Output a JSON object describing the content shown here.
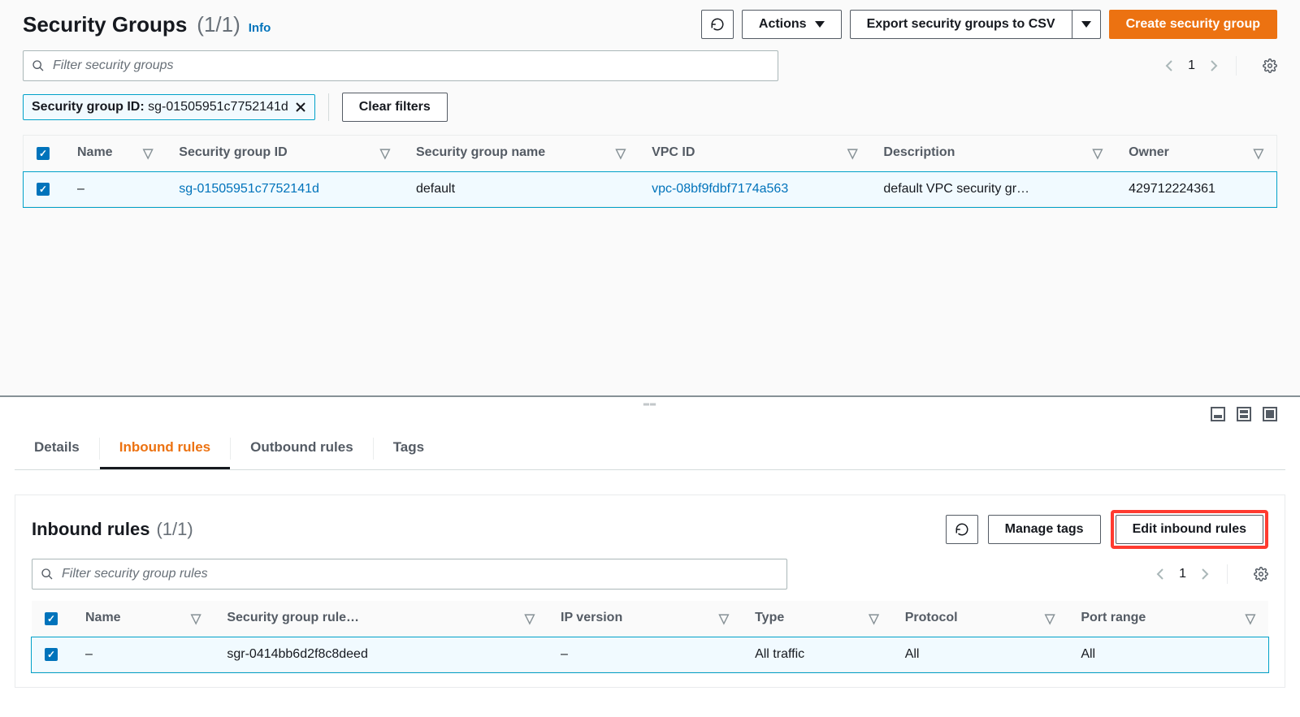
{
  "header": {
    "title": "Security Groups",
    "count": "(1/1)",
    "info": "Info"
  },
  "toolbar": {
    "actions": "Actions",
    "export": "Export security groups to CSV",
    "create": "Create security group"
  },
  "filter": {
    "placeholder": "Filter security groups",
    "chip_label": "Security group ID:",
    "chip_value": "sg-01505951c7752141d",
    "clear": "Clear filters",
    "page": "1"
  },
  "table": {
    "cols": [
      "Name",
      "Security group ID",
      "Security group name",
      "VPC ID",
      "Description",
      "Owner"
    ],
    "rows": [
      {
        "name": "–",
        "sgid": "sg-01505951c7752141d",
        "sgname": "default",
        "vpcid": "vpc-08bf9fdbf7174a563",
        "desc": "default VPC security gr…",
        "owner": "429712224361"
      }
    ]
  },
  "tabs": {
    "details": "Details",
    "inbound": "Inbound rules",
    "outbound": "Outbound rules",
    "tags": "Tags"
  },
  "detail": {
    "title": "Inbound rules",
    "count": "(1/1)",
    "manage": "Manage tags",
    "edit": "Edit inbound rules",
    "filter_placeholder": "Filter security group rules",
    "page": "1",
    "cols": [
      "Name",
      "Security group rule…",
      "IP version",
      "Type",
      "Protocol",
      "Port range"
    ],
    "rows": [
      {
        "name": "–",
        "ruleid": "sgr-0414bb6d2f8c8deed",
        "ipver": "–",
        "type": "All traffic",
        "proto": "All",
        "port": "All"
      }
    ]
  }
}
